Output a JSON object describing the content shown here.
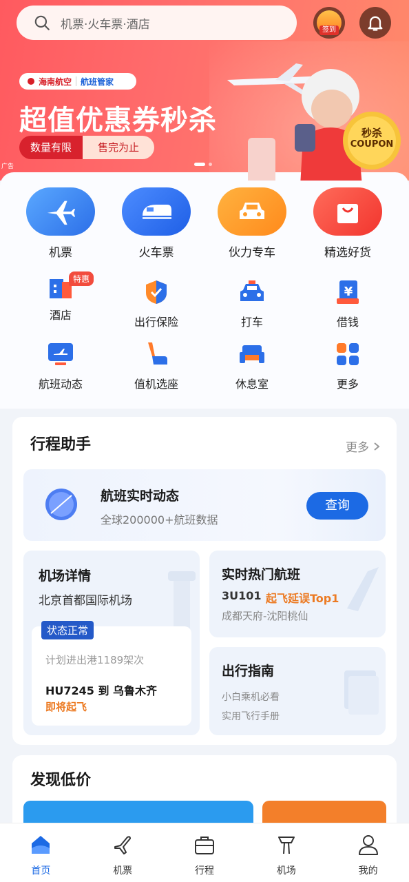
{
  "search": {
    "placeholder": "机票·火车票·酒店"
  },
  "header": {
    "signin_label": "签到"
  },
  "banner": {
    "brand_a": "海南航空",
    "brand_b": "航班管家",
    "title": "超值优惠券秒杀",
    "tag_a": "数量有限",
    "tag_b": "售完为止",
    "ad_label": "广告",
    "coupon_top": "秒杀",
    "coupon_bottom": "COUPON"
  },
  "services": {
    "big": [
      {
        "label": "机票",
        "icon": "plane-icon",
        "color": "#3a8cf0"
      },
      {
        "label": "火车票",
        "icon": "train-icon",
        "color": "#2a6ff0"
      },
      {
        "label": "伙力专车",
        "icon": "car-icon",
        "color": "#ff9d2a"
      },
      {
        "label": "精选好货",
        "icon": "shopping-bag-icon",
        "color": "#ff4d3f"
      }
    ],
    "small": [
      {
        "label": "酒店",
        "icon": "hotel-icon",
        "badge": "特惠"
      },
      {
        "label": "出行保险",
        "icon": "shield-icon"
      },
      {
        "label": "打车",
        "icon": "taxi-icon"
      },
      {
        "label": "借钱",
        "icon": "yuan-icon"
      },
      {
        "label": "航班动态",
        "icon": "flight-status-icon"
      },
      {
        "label": "值机选座",
        "icon": "seat-icon"
      },
      {
        "label": "休息室",
        "icon": "lounge-icon"
      },
      {
        "label": "更多",
        "icon": "more-grid-icon"
      }
    ]
  },
  "trip": {
    "title": "行程助手",
    "more": "更多",
    "flight_status": {
      "title": "航班实时动态",
      "sub": "全球200000+航班数据",
      "button": "查询"
    },
    "airport": {
      "title": "机场详情",
      "name": "北京首都国际机场",
      "status": "状态正常",
      "plan": "计划进出港1189架次",
      "flight": "HU7245 到 乌鲁木齐",
      "takeoff": "即将起飞"
    },
    "hot": {
      "title": "实时热门航班",
      "code": "3U101",
      "delay": "起飞延误Top1",
      "route": "成都天府-沈阳桃仙"
    },
    "guide": {
      "title": "出行指南",
      "line1": "小白乘机必看",
      "line2": "实用飞行手册"
    }
  },
  "low_price": {
    "title": "发现低价"
  },
  "tabs": [
    {
      "label": "首页",
      "icon": "home-icon",
      "active": true
    },
    {
      "label": "机票",
      "icon": "plane-outline-icon"
    },
    {
      "label": "行程",
      "icon": "luggage-icon"
    },
    {
      "label": "机场",
      "icon": "airport-tower-icon"
    },
    {
      "label": "我的",
      "icon": "user-icon"
    }
  ],
  "colors": {
    "primary": "#1c6ae4",
    "banner_red": "#ff5a5f",
    "orange": "#ec7a22"
  }
}
